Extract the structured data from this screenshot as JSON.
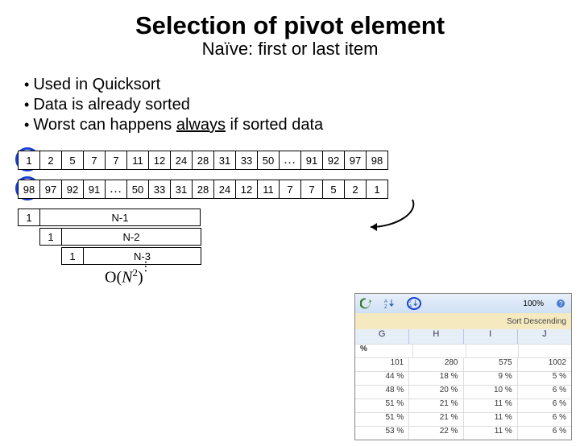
{
  "title": "Selection of pivot element",
  "subtitle": "Naïve: first or last item",
  "bullets": [
    "Used in Quicksort",
    "Data is already sorted",
    {
      "pre": "Worst can happens ",
      "u": "always",
      "post": " if sorted data"
    }
  ],
  "arrays": {
    "asc": [
      "1",
      "2",
      "5",
      "7",
      "7",
      "11",
      "12",
      "24",
      "28",
      "31",
      "33",
      "50",
      "…",
      "91",
      "92",
      "97",
      "98"
    ],
    "desc": [
      "98",
      "97",
      "92",
      "91",
      "…",
      "50",
      "33",
      "31",
      "28",
      "24",
      "12",
      "11",
      "7",
      "7",
      "5",
      "2",
      "1"
    ]
  },
  "recursion": [
    {
      "one": "1",
      "rest": "N-1"
    },
    {
      "one": "1",
      "rest": "N-2"
    },
    {
      "one": "1",
      "rest": "N-3"
    }
  ],
  "vdots": "…",
  "complexity": {
    "pre": "O(",
    "var": "N",
    "exp": "2",
    "post": ")"
  },
  "toolbar": {
    "tooltip": "Sort Descending",
    "zoom": "100%",
    "cols": [
      "G",
      "H",
      "I",
      "J"
    ],
    "rows": [
      [
        "%",
        "",
        "",
        ""
      ],
      [
        "101",
        "280",
        "575",
        "1002"
      ],
      [
        "44 %",
        "18 %",
        "9 %",
        "5 %"
      ],
      [
        "48 %",
        "20 %",
        "10 %",
        "6 %"
      ],
      [
        "51 %",
        "21 %",
        "11 %",
        "6 %"
      ],
      [
        "51 %",
        "21 %",
        "11 %",
        "6 %"
      ],
      [
        "53 %",
        "22 %",
        "11 %",
        "6 %"
      ]
    ]
  },
  "chart_data": {
    "type": "table",
    "title": "",
    "columns": [
      "G",
      "H",
      "I",
      "J"
    ],
    "rows": [
      [
        101,
        280,
        575,
        1002
      ],
      [
        "44 %",
        "18 %",
        "9 %",
        "5 %"
      ],
      [
        "48 %",
        "20 %",
        "10 %",
        "6 %"
      ],
      [
        "51 %",
        "21 %",
        "11 %",
        "6 %"
      ],
      [
        "51 %",
        "21 %",
        "11 %",
        "6 %"
      ],
      [
        "53 %",
        "22 %",
        "11 %",
        "6 %"
      ]
    ]
  }
}
